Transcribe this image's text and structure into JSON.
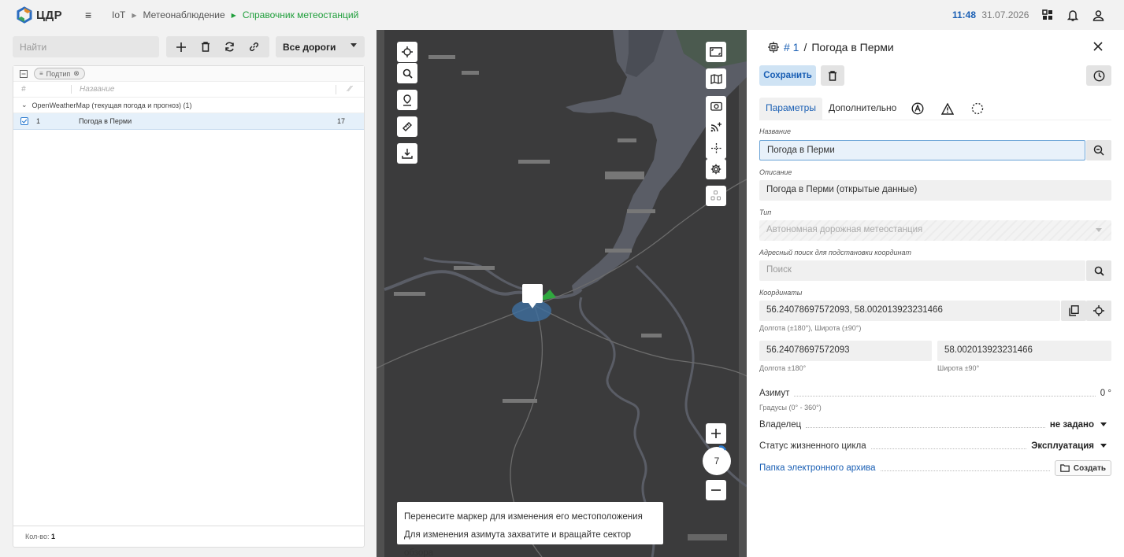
{
  "topbar": {
    "logo_text": "ЦДР",
    "menu_icon": "hamburger-icon",
    "breadcrumbs": [
      "IoT",
      "Метеонаблюдение",
      "Справочник метеостанций"
    ],
    "time": "11:48",
    "date": "31.07.2026"
  },
  "left": {
    "search_placeholder": "Найти",
    "roads_select": "Все дороги",
    "filter_chip": "Подтип",
    "columns": {
      "num": "#",
      "name": "Название"
    },
    "group_label": "OpenWeatherMap (текущая погода и прогноз) (1)",
    "rows": [
      {
        "num": "1",
        "name": "Погода в Перми",
        "value": "17"
      }
    ],
    "count_label": "Кол-во:",
    "count_value": "1"
  },
  "map": {
    "hint_line1": "Перенесите маркер для изменения его местоположения",
    "hint_line2": "Для изменения азимута захватите и вращайте сектор обзора",
    "zoom_level": "7"
  },
  "right": {
    "title_num": "# 1",
    "title_sep": "/",
    "title_name": "Погода в Перми",
    "save_label": "Сохранить",
    "tabs": [
      "Параметры",
      "Дополнительно"
    ],
    "fields": {
      "name_label": "Название",
      "name_value": "Погода в Перми",
      "desc_label": "Описание",
      "desc_value": "Погода в Перми (открытые данные)",
      "type_label": "Тип",
      "type_value": "Автономная дорожная метеостанция",
      "addr_label": "Адресный поиск для подстановки координат",
      "addr_placeholder": "Поиск",
      "coords_label": "Координаты",
      "coords_value": "56.24078697572093, 58.002013923231466",
      "coords_hint": "Долгота (±180°), Широта (±90°)",
      "lon_value": "56.24078697572093",
      "lat_value": "58.002013923231466",
      "lon_hint": "Долгота ±180°",
      "lat_hint": "Широта ±90°",
      "azimuth_label": "Азимут",
      "azimuth_value": "0 °",
      "azimuth_hint": "Градусы (0° - 360°)",
      "owner_label": "Владелец",
      "owner_value": "не задано",
      "status_label": "Статус жизненного цикла",
      "status_value": "Эксплуатация",
      "archive_label": "Папка электронного архива",
      "create_label": "Создать"
    }
  },
  "colors": {
    "accent": "#1a5fb4",
    "green": "#1e9e3a"
  }
}
